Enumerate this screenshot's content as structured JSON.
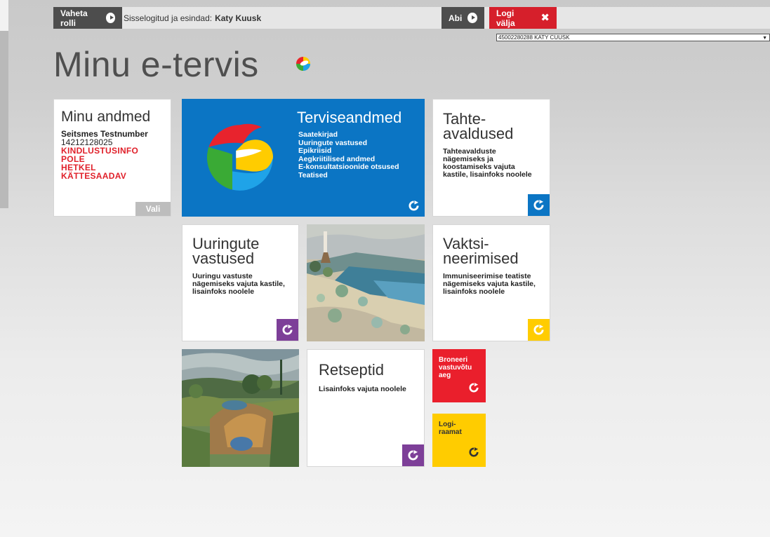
{
  "colors": {
    "blue": "#0b75c4",
    "red": "#d61f2b",
    "purple": "#7d3f98",
    "yellow": "#ffcc00",
    "dark": "#4d4d4d"
  },
  "topbar": {
    "role_button": "Vaheta rolli",
    "logged_in_prefix": "Sisselogitud ja esindad:",
    "logged_in_user": "Katy Kuusk",
    "help_button": "Abi",
    "logout_button": "Logi välja",
    "person_select_value": "45002280288 KATY CUUSK"
  },
  "header": {
    "title": "Minu e-tervis"
  },
  "tiles": {
    "minu_andmed": {
      "title": "Minu andmed",
      "name": "Seitsmes Testnumber",
      "code": "14212128025",
      "warning_line1": "KINDLUSTUSINFO POLE",
      "warning_line2": "HETKEL KÄTTESAADAV",
      "select_button": "Vali"
    },
    "terviseandmed": {
      "title": "Terviseandmed",
      "links": [
        "Saatekirjad",
        "Uuringute vastused",
        "Epikriisid",
        "Aegkriitilised andmed",
        "E-konsultatsioonide otsused",
        "Teatised"
      ]
    },
    "tahteavaldused": {
      "title_line1": "Tahte-",
      "title_line2": "avaldused",
      "desc": "Tahteavalduste nägemiseks ja koostamiseks vajuta kastile, lisainfoks noolele"
    },
    "uuringute_vastused": {
      "title_line1": "Uuringute",
      "title_line2": "vastused",
      "desc": "Uuringu vastuste nägemiseks vajuta kastile, lisainfoks noolele"
    },
    "vaktsineerimised": {
      "title_line1": "Vaktsi-",
      "title_line2": "neerimised",
      "desc": "Immuniseerimise teatiste nägemiseks vajuta kastile, lisainfoks noolele"
    },
    "retseptid": {
      "title": "Retseptid",
      "desc": "Lisainfoks vajuta noolele"
    },
    "broneeri": {
      "line1": "Broneeri",
      "line2": "vastuvõtu",
      "line3": "aeg"
    },
    "logiraamat": {
      "line1": "Logi-",
      "line2": "raamat"
    }
  },
  "icons": {
    "role": "circle-play-icon",
    "help": "circle-play-icon",
    "logout": "close-icon",
    "tile_arrow": "refresh-arrow-icon",
    "logo": "e-tervis-logo"
  }
}
